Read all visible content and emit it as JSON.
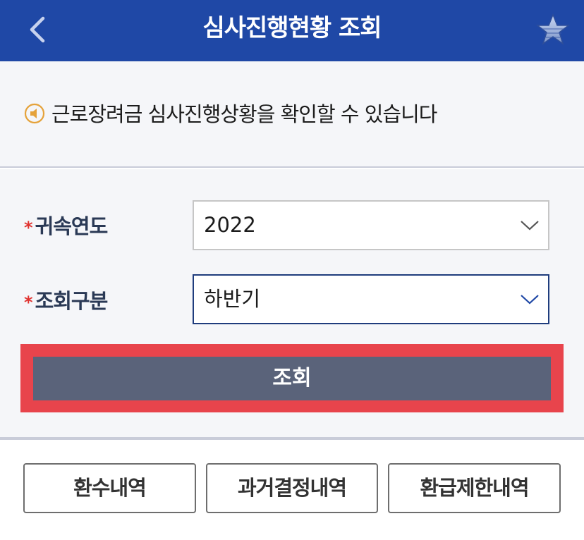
{
  "header": {
    "title": "심사진행현황 조회",
    "back_icon": "chevron-left-icon",
    "favorite_icon": "star-icon"
  },
  "notice": {
    "icon": "speaker-icon",
    "text": "근로장려금 심사진행상황을 확인할 수 있습니다"
  },
  "form": {
    "required_mark": "*",
    "year": {
      "label": "귀속연도",
      "value": "2022"
    },
    "period": {
      "label": "조회구분",
      "value": "하반기"
    },
    "search_label": "조회"
  },
  "bottom_buttons": [
    {
      "label": "환수내역"
    },
    {
      "label": "과거결정내역"
    },
    {
      "label": "환급제한내역"
    }
  ],
  "colors": {
    "header_bg": "#1f48a6",
    "primary_button": "#5a637a",
    "highlight": "#e8444c",
    "required": "#e0322f"
  }
}
